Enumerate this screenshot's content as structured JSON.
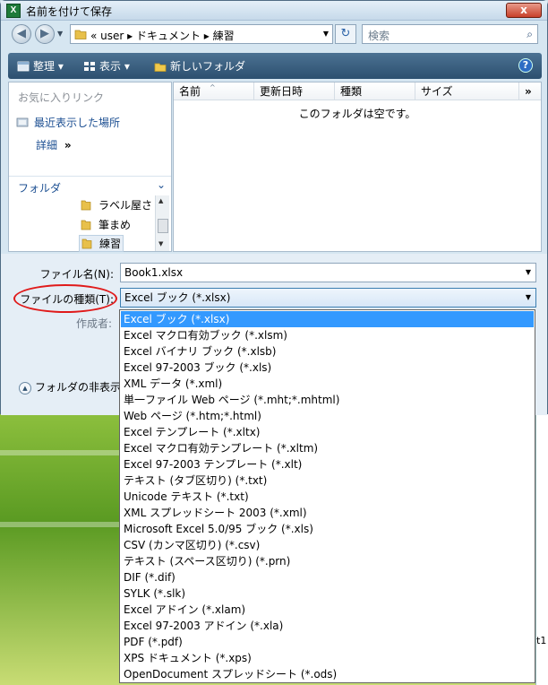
{
  "window": {
    "title": "名前を付けて保存",
    "app_icon_letter": "X",
    "close_glyph": "x"
  },
  "address": {
    "crumbs": "« user ▸ ドキュメント ▸ 練習",
    "search_placeholder": "検索"
  },
  "toolbar": {
    "organize": "整理",
    "views": "表示",
    "new_folder": "新しいフォルダ",
    "help": "?"
  },
  "left_pane": {
    "favorites_heading": "お気に入りリンク",
    "recent": "最近表示した場所",
    "details": "詳細",
    "details_more": "»",
    "folders_heading": "フォルダ",
    "tree": [
      "ラベル屋さ",
      "筆まめ",
      "練習"
    ]
  },
  "file_list": {
    "columns": [
      "名前",
      "更新日時",
      "種類",
      "サイズ"
    ],
    "more": "»",
    "empty_message": "このフォルダは空です。"
  },
  "form": {
    "filename_label": "ファイル名(N):",
    "filename_value": "Book1.xlsx",
    "filetype_label": "ファイルの種類(T):",
    "filetype_value": "Excel ブック (*.xlsx)",
    "author_label": "作成者:",
    "hide_folders": "フォルダの非表示"
  },
  "filetype_options": [
    "Excel ブック (*.xlsx)",
    "Excel マクロ有効ブック (*.xlsm)",
    "Excel バイナリ ブック (*.xlsb)",
    "Excel 97-2003 ブック (*.xls)",
    "XML データ (*.xml)",
    "単一ファイル Web ページ (*.mht;*.mhtml)",
    "Web ページ (*.htm;*.html)",
    "Excel テンプレート (*.xltx)",
    "Excel マクロ有効テンプレート (*.xltm)",
    "Excel 97-2003 テンプレート (*.xlt)",
    "テキスト (タブ区切り) (*.txt)",
    "Unicode テキスト (*.txt)",
    "XML スプレッドシート 2003 (*.xml)",
    "Microsoft Excel 5.0/95 ブック (*.xls)",
    "CSV (カンマ区切り) (*.csv)",
    "テキスト (スペース区切り) (*.prn)",
    "DIF (*.dif)",
    "SYLK (*.slk)",
    "Excel アドイン (*.xlam)",
    "Excel 97-2003 アドイン (*.xla)",
    "PDF (*.pdf)",
    "XPS ドキュメント (*.xps)",
    "OpenDocument スプレッドシート (*.ods)"
  ],
  "selected_option_index": 0,
  "background": {
    "sheet_fragment": "t1"
  },
  "colors": {
    "selection": "#3399ff",
    "annotation_oval": "#e01a1a",
    "toolbar": "#2c4f6f"
  }
}
